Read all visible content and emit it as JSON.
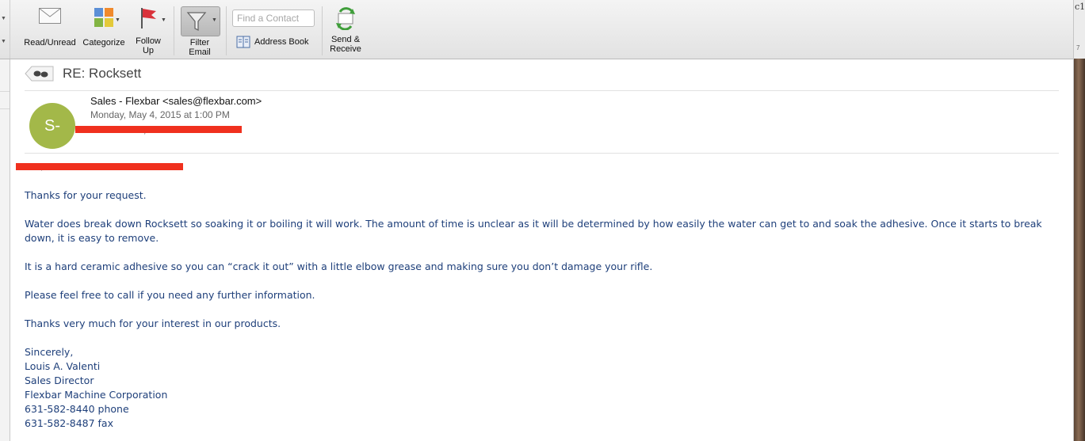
{
  "toolbar": {
    "read_unread": "Read/Unread",
    "categorize": "Categorize",
    "follow_up": "Follow\nUp",
    "filter_email": "Filter\nEmail",
    "find_contact_placeholder": "Find a Contact",
    "address_book": "Address Book",
    "send_receive": "Send &\nReceive"
  },
  "edge": {
    "top_text": "c1",
    "small_text": "7"
  },
  "message": {
    "subject": "RE: Rocksett",
    "avatar_initials": "S-",
    "sender": "Sales - Flexbar <sales@flexbar.com>",
    "date": "Monday, May 4, 2015 at 1:00 PM",
    "body": [
      "Thanks for your request.",
      "Water does break down Rocksett so soaking it or boiling it will work.  The amount of time is unclear as it will be determined by how easily the water can get to and soak the adhesive.  Once it starts to break down, it is easy to remove.",
      "It is a hard ceramic adhesive so you can “crack it out” with a little elbow grease and making sure you don’t damage your rifle.",
      "Please feel free to call if you need any further information.",
      "Thanks very much for your interest in our products."
    ],
    "signature": {
      "closing": "Sincerely,",
      "name": "Louis A. Valenti",
      "title": "Sales Director",
      "company": "Flexbar Machine Corporation",
      "phone": "631-582-8440 phone",
      "fax": "631-582-8487 fax"
    }
  },
  "colors": {
    "avatar": "#a3b849",
    "redaction": "#f0301e",
    "body_text": "#1e3f7a"
  }
}
